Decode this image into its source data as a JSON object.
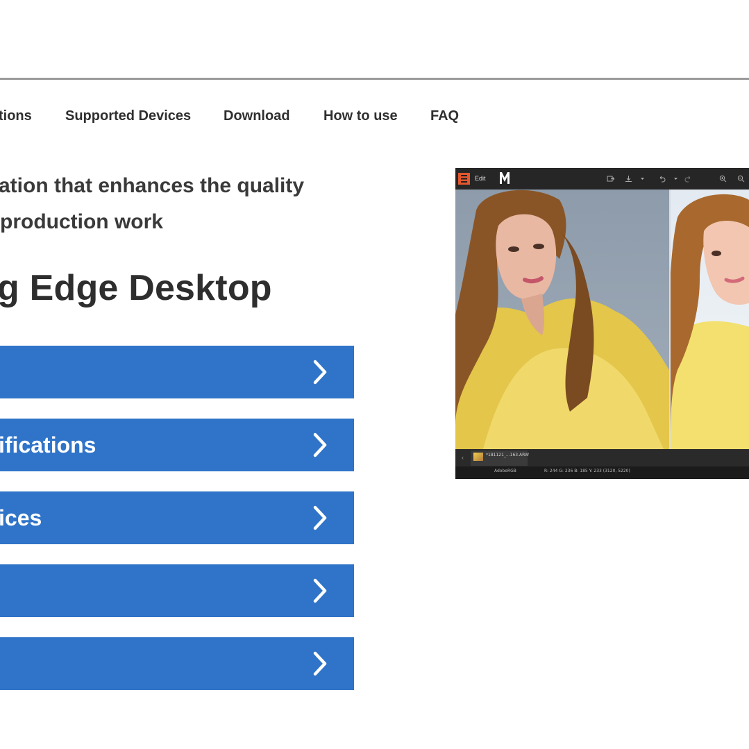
{
  "nav": {
    "items": [
      {
        "label": "tions"
      },
      {
        "label": "Supported Devices"
      },
      {
        "label": "Download"
      },
      {
        "label": "How to use"
      },
      {
        "label": "FAQ"
      }
    ]
  },
  "hero": {
    "tagline_line1": "ation that enhances the quality",
    "tagline_line2": "production work",
    "product_title": "g Edge Desktop"
  },
  "menu": {
    "buttons": [
      {
        "label": ""
      },
      {
        "label": "ifications"
      },
      {
        "label": "ices"
      },
      {
        "label": ""
      },
      {
        "label": ""
      }
    ],
    "accent": "#2f74c8"
  },
  "app_screenshot": {
    "toolbar_edit_label": "Edit",
    "filmstrip_file": "*181121_...163.ARW",
    "status_colorspace": "AdobeRGB",
    "status_readout": "R: 244  G: 236  B: 185  Y: 233    (3120, 5220)"
  }
}
